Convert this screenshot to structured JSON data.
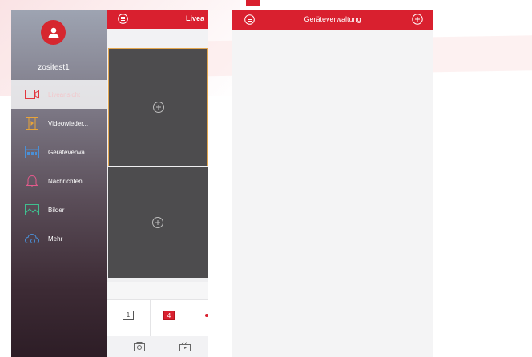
{
  "colors": {
    "accent": "#d9202f",
    "tile_border": "#e2a64f",
    "video_tile": "#4d4c4e"
  },
  "drawer": {
    "username": "zositest1",
    "items": [
      {
        "label": "Liveansicht",
        "icon": "camera-icon",
        "active": true
      },
      {
        "label": "Videowieder...",
        "icon": "film-icon",
        "active": false
      },
      {
        "label": "Geräteverwa...",
        "icon": "device-icon",
        "active": false
      },
      {
        "label": "Nachrichten...",
        "icon": "bell-icon",
        "active": false
      },
      {
        "label": "Bilder",
        "icon": "image-icon",
        "active": false
      },
      {
        "label": "Mehr",
        "icon": "cloud-settings-icon",
        "active": false
      }
    ]
  },
  "live": {
    "title": "Livea",
    "layout_one": "1",
    "layout_four": "4"
  },
  "device_management": {
    "title": "Geräteverwaltung"
  }
}
